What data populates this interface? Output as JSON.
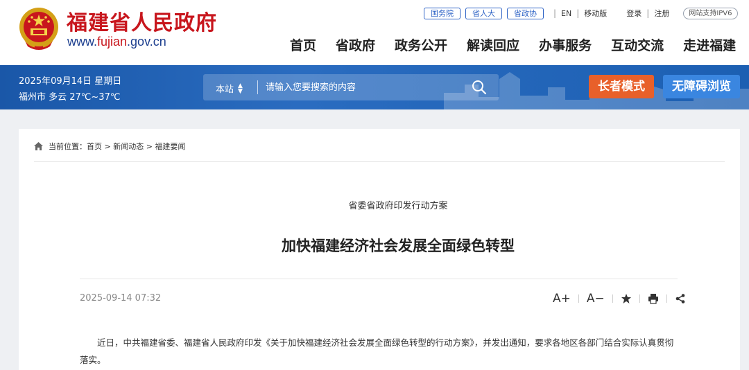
{
  "header": {
    "site_name": "福建省人民政府",
    "url_prefix": "www.",
    "url_highlight": "fujian",
    "url_suffix": ".gov.cn",
    "top_pills": [
      "国务院",
      "省人大",
      "省政协"
    ],
    "top_links": {
      "en": "EN",
      "mobile": "移动版",
      "login": "登录",
      "register": "注册"
    },
    "ipv6": "网站支持IPV6",
    "nav": [
      "首页",
      "省政府",
      "政务公开",
      "解读回应",
      "办事服务",
      "互动交流",
      "走进福建"
    ]
  },
  "band": {
    "date": "2025年09月14日 星期日",
    "weather": "福州市 多云 27℃~37℃",
    "search_scope": "本站",
    "search_placeholder": "请输入您要搜索的内容",
    "elder_mode": "长者模式",
    "accessible": "无障碍浏览"
  },
  "article": {
    "breadcrumb": {
      "prefix": "当前位置：",
      "items": [
        "首页",
        "新闻动态",
        "福建要闻"
      ],
      "separator": " > "
    },
    "subtitle": "省委省政府印发行动方案",
    "title": "加快福建经济社会发展全面绿色转型",
    "date": "2025-09-14 07:32",
    "tools": {
      "font_up": "A+",
      "font_down": "A−"
    },
    "body": "近日，中共福建省委、福建省人民政府印发《关于加快福建经济社会发展全面绿色转型的行动方案》，并发出通知，要求各地区各部门结合实际认真贯彻落实。"
  },
  "colors": {
    "brand_red": "#c8161d",
    "band_blue": "#1f5fb0",
    "elder_orange": "#e8602a",
    "access_blue": "#3a86e0"
  },
  "icons": [
    "national-emblem-icon",
    "search-icon",
    "home-icon",
    "star-icon",
    "print-icon",
    "share-icon"
  ]
}
